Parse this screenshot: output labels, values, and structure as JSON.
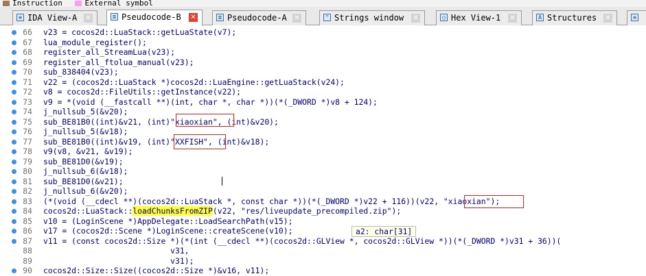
{
  "legend": {
    "items": [
      {
        "label": "Instruction",
        "color": "#a0785a"
      },
      {
        "label": "External symbol",
        "color": "#ff9cf0"
      }
    ]
  },
  "tabs": [
    {
      "label": "IDA View-A",
      "icon": "disassembly-icon",
      "active": false
    },
    {
      "label": "Pseudocode-B",
      "icon": "pseudocode-icon",
      "active": true
    },
    {
      "label": "Pseudocode-A",
      "icon": "pseudocode-icon",
      "active": false
    },
    {
      "label": "Strings window",
      "icon": "strings-icon",
      "active": false
    },
    {
      "label": "Hex View-1",
      "icon": "hex-icon",
      "active": false
    },
    {
      "label": "Structures",
      "icon": "structures-icon",
      "active": false
    },
    {
      "label": "",
      "icon": "enums-icon",
      "active": false
    }
  ],
  "code": [
    {
      "num": "66",
      "text": "v23 = cocos2d::LuaStack::getLuaState(v7);"
    },
    {
      "num": "67",
      "text": "lua_module_register();"
    },
    {
      "num": "68",
      "text": "register_all_StreamLua(v23);"
    },
    {
      "num": "69",
      "text": "register_all_ftolua_manual(v23);"
    },
    {
      "num": "70",
      "text": "sub_838404(v23);"
    },
    {
      "num": "71",
      "text": "v22 = (cocos2d::LuaStack *)cocos2d::LuaEngine::getLuaStack(v24);"
    },
    {
      "num": "72",
      "text": "v8 = cocos2d::FileUtils::getInstance(v22);"
    },
    {
      "num": "73",
      "text": "v9 = *(void (__fastcall **)(int, char *, char *))(*(_DWORD *)v8 + 124);"
    },
    {
      "num": "74",
      "text": "j_nullsub_5(&v20);"
    },
    {
      "num": "75",
      "text": "sub_BE81B0((int)&v21, (int)\"xiaoxian\", (int)&v20);"
    },
    {
      "num": "76",
      "text": "j_nullsub_5(&v18);"
    },
    {
      "num": "77",
      "text": "sub_BE81B0((int)&v19, (int)\"XXFISH\", (int)&v18);"
    },
    {
      "num": "78",
      "text": "v9(v8, &v21, &v19);"
    },
    {
      "num": "79",
      "text": "sub_BE81D0(&v19);"
    },
    {
      "num": "80",
      "text": "j_nullsub_6(&v18);"
    },
    {
      "num": "81",
      "text": "sub_BE81D0(&v21);"
    },
    {
      "num": "82",
      "text": "j_nullsub_6(&v20);"
    },
    {
      "num": "83",
      "text": "(*(void (__cdecl **)(cocos2d::LuaStack *, const char *))(*(_DWORD *)v22 + 116))(v22, \"xiaoxian\");"
    },
    {
      "num": "84",
      "pre": "cocos2d::LuaStack::",
      "hl": "loadChunksFromZIP",
      "post": "(v22, \"res/liveupdate_precompiled.zip\");"
    },
    {
      "num": "85",
      "text": "v10 = (LoginScene *)AppDelegate::LoadSearchPath(v15);"
    },
    {
      "num": "86",
      "text": "v17 = (cocos2d::Scene *)LoginScene::createScene(v10);"
    },
    {
      "num": "87",
      "text": "v11 = (const cocos2d::Size *)(*(int (__cdecl **)(cocos2d::GLView *, cocos2d::GLView *))(*(_DWORD *)v31 + 36))("
    },
    {
      "num": "88",
      "text": "                           v31,"
    },
    {
      "num": "89",
      "text": "                           v31);"
    },
    {
      "num": "90",
      "text": "cocos2d::Size::Size((cocos2d::Size *)&v16, v11);"
    }
  ],
  "tooltip": "a2: char[31]"
}
